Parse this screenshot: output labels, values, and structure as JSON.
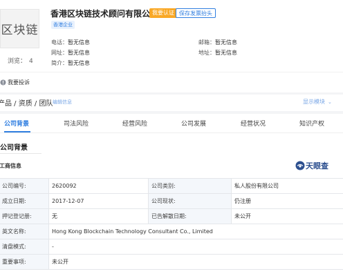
{
  "header": {
    "logo_text": "区块链",
    "views_label": "浏览：",
    "views_count": "4",
    "company_name": "香港区块链技术顾问有限公司",
    "claim_button": "我要认证",
    "invoice_button": "保存发票抬头",
    "tag": "香港企业",
    "phone_label": "电话：",
    "phone_value": "暂无信息",
    "email_label": "邮箱：",
    "email_value": "暂无信息",
    "website_label": "网址：",
    "website_value": "暂无信息",
    "address_label": "地址：",
    "address_value": "暂无信息",
    "intro_label": "简介：",
    "intro_value": "暂无信息"
  },
  "report": {
    "label": "我要投诉"
  },
  "products": {
    "title": "产品 / 资质 / 团队",
    "edit_label": "编辑信息",
    "show_label": "显示模块"
  },
  "tabs": [
    {
      "label": "公司背景",
      "active": true
    },
    {
      "label": "司法风险",
      "active": false
    },
    {
      "label": "经营风险",
      "active": false
    },
    {
      "label": "公司发展",
      "active": false
    },
    {
      "label": "经营状况",
      "active": false
    },
    {
      "label": "知识产权",
      "active": false
    }
  ],
  "section": {
    "title": "公司背景",
    "subtitle": "工商信息",
    "brand": "天眼查"
  },
  "registration": [
    [
      "公司编号:",
      "2620092",
      "公司类别:",
      "私人股份有限公司"
    ],
    [
      "成立日期:",
      "2017-12-07",
      "公司现状:",
      "仍注册"
    ],
    [
      "押记登记册:",
      "无",
      "已告解散日期:",
      "未公开"
    ],
    [
      "英文名称:",
      "Hong Kong Blockchain Technology Consultant Co., Limited"
    ],
    [
      "清盘模式:",
      "-"
    ],
    [
      "重要事项:",
      "未公开"
    ]
  ],
  "colors": {
    "accent": "#2f7ee0",
    "claim": "#f9a826",
    "table_key_bg": "#f4f7fb",
    "brand": "#2c4f8f"
  }
}
